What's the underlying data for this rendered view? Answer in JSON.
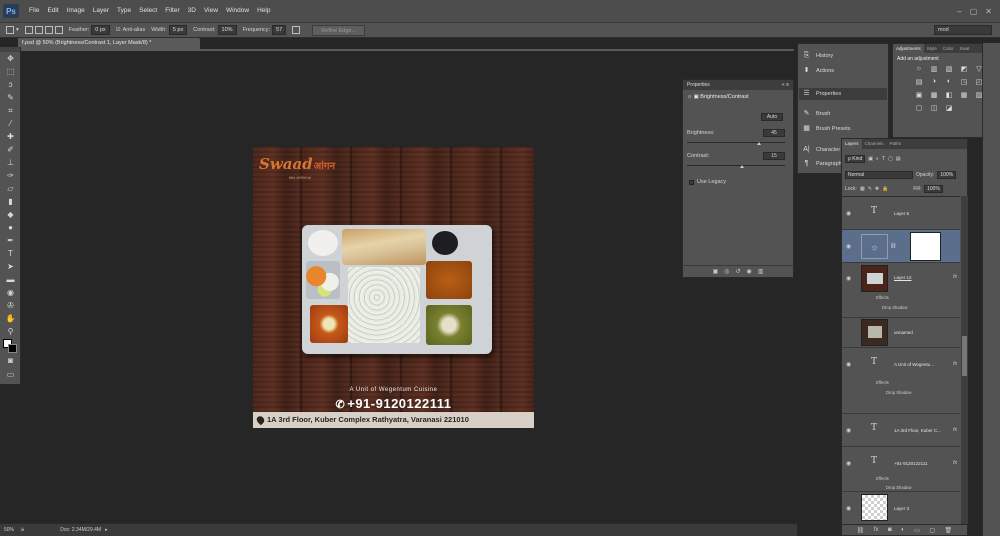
{
  "app": {
    "logo": "Ps"
  },
  "menu": [
    "File",
    "Edit",
    "Image",
    "Layer",
    "Type",
    "Select",
    "Filter",
    "3D",
    "View",
    "Window",
    "Help"
  ],
  "window_controls": [
    "–",
    "▢",
    "✕"
  ],
  "options_bar": {
    "feather_label": "Feather:",
    "feather_value": "0 px",
    "antialias_label": "Anti-alias",
    "width_label": "Width:",
    "width_value": "5 px",
    "contrast_label": "Contrast:",
    "contrast_value": "10%",
    "frequency_label": "Frequency:",
    "frequency_value": "57",
    "refine_edge": "Refine Edge...",
    "workspace": "mod"
  },
  "document_tab": "f.psd @ 50% (Brightness/Contrast 1, Layer Mask/8) *",
  "status": {
    "zoom": "50%",
    "doc": "Doc: 2.34M/29.4M"
  },
  "canvas": {
    "logo_text": "Swaad",
    "logo_devanagari": "आंगन",
    "logo_tagline": "स्वाद अपनेपन का",
    "unit_line": "A Unit of Wegentum Cuisine",
    "phone": "+91-9120122111",
    "address": "1A 3rd Floor, Kuber Complex Rathyatra, Varanasi 221010"
  },
  "properties": {
    "tab": "Properties",
    "close": "«  ≡",
    "title": "Brightness/Contrast",
    "auto": "Auto",
    "brightness_label": "Brightness:",
    "brightness_value": "45",
    "contrast_label": "Contrast:",
    "contrast_value": "15",
    "brightness_fraction": 0.73,
    "contrast_fraction": 0.56,
    "legacy_label": "Use Legacy"
  },
  "strip": {
    "items": [
      {
        "icon": "⎘",
        "label": "History"
      },
      {
        "icon": "⬍",
        "label": "Actions"
      },
      {
        "icon": "☰",
        "label": "Properties"
      },
      {
        "icon": "✎",
        "label": "Brush"
      },
      {
        "icon": "▦",
        "label": "Brush Presets"
      },
      {
        "icon": "A|",
        "label": "Character"
      },
      {
        "icon": "¶",
        "label": "Paragraph"
      }
    ]
  },
  "adjustments": {
    "tabs": [
      "Adjustments",
      "Style",
      "Color",
      "Swat"
    ],
    "heading": "Add an adjustment",
    "icons": [
      "☼",
      "▥",
      "▧",
      "◩",
      "▽",
      "▤",
      "◑",
      "◐",
      "◳",
      "◰",
      "▣",
      "▩",
      "◧",
      "▦",
      "▨",
      "▢",
      "◫",
      "◪"
    ]
  },
  "layers": {
    "tabs": [
      "Layers",
      "Channels",
      "Paths"
    ],
    "kind": "ρ Kind",
    "blend": "Normal",
    "opacity_label": "Opacity:",
    "opacity_value": "100%",
    "lock_label": "Lock:",
    "fill_label": "Fill:",
    "fill_value": "100%",
    "items": [
      {
        "name": "Layer 5",
        "fx": ""
      },
      {
        "name": "",
        "fx": ""
      },
      {
        "name": "Layer 12",
        "fx": "fx",
        "sub1": "Effects",
        "sub2": "Drop Shadow"
      },
      {
        "name": "unnamed",
        "fx": ""
      },
      {
        "name": "A Unit of Wegentu...",
        "fx": "fx",
        "sub1": "Effects",
        "sub2": "Drop Shadow"
      },
      {
        "name": "1A 3rd Floor, Kuber C...",
        "fx": "fx"
      },
      {
        "name": "+91-9120122111",
        "fx": "fx",
        "sub1": "Effects",
        "sub2": "Drop Shadow"
      },
      {
        "name": "Layer 3",
        "fx": ""
      }
    ],
    "footer": [
      "⛓",
      "fx",
      "◙",
      "◐",
      "▭",
      "▢",
      "🗑"
    ]
  },
  "colors": {
    "accent": "#6fb9ff",
    "panel": "#535353",
    "selected_layer": "#5b6f8c"
  }
}
